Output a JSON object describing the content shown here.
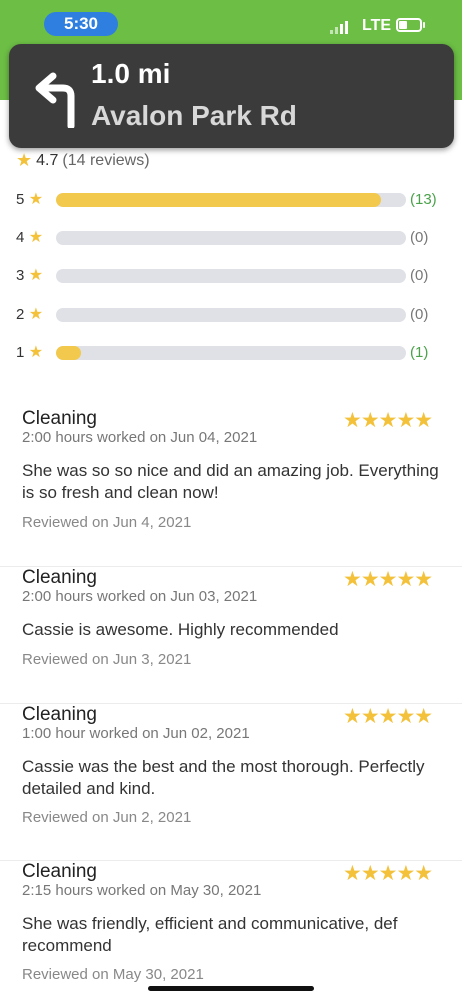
{
  "status_bar": {
    "time": "5:30",
    "network": "LTE",
    "background_color": "#6cbe45",
    "time_pill_color": "#2f7fe0"
  },
  "navigation": {
    "turn_icon": "turn-left-arrow-icon",
    "distance": "1.0 mi",
    "street": "Avalon Park Rd"
  },
  "rating_summary": {
    "average": "4.7",
    "reviews_text": "(14 reviews)",
    "star_icon": "star-icon",
    "breakdown": [
      {
        "label": "5",
        "count": "(13)",
        "fraction": 0.929
      },
      {
        "label": "4",
        "count": "(0)",
        "fraction": 0
      },
      {
        "label": "3",
        "count": "(0)",
        "fraction": 0
      },
      {
        "label": "2",
        "count": "(0)",
        "fraction": 0
      },
      {
        "label": "1",
        "count": "(1)",
        "fraction": 0.071
      }
    ]
  },
  "reviews": [
    {
      "title": "Cleaning",
      "stars": 5,
      "meta": "2:00 hours worked on Jun 04, 2021",
      "body": "She was so so nice and did an amazing job. Everything is so fresh and clean now!",
      "reviewed": "Reviewed on Jun 4, 2021"
    },
    {
      "title": "Cleaning",
      "stars": 5,
      "meta": "2:00 hours worked on Jun 03, 2021",
      "body": "Cassie is awesome. Highly recommended",
      "reviewed": "Reviewed on Jun 3, 2021"
    },
    {
      "title": "Cleaning",
      "stars": 5,
      "meta": "1:00 hour worked on Jun 02, 2021",
      "body": "Cassie was the best and the most thorough.  Perfectly detailed and kind.",
      "reviewed": "Reviewed on Jun 2, 2021"
    },
    {
      "title": "Cleaning",
      "stars": 5,
      "meta": "2:15 hours worked on May 30, 2021",
      "body": "She was friendly, efficient and communicative, def recommend",
      "reviewed": "Reviewed on May 30, 2021"
    }
  ],
  "colors": {
    "star": "#f3c13a",
    "bar_fill": "#f2c94c",
    "bar_track": "#dfe1e6",
    "count_positive": "#4aa24a"
  }
}
